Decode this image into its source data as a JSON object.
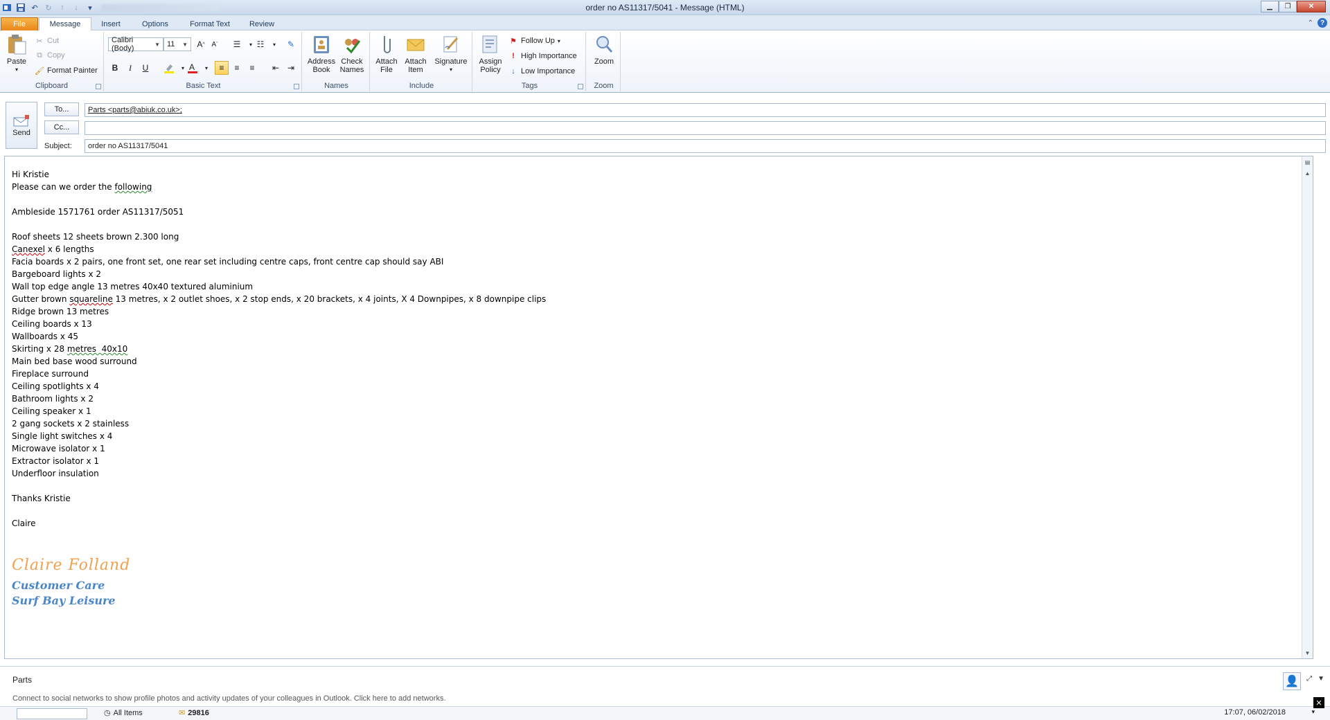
{
  "window": {
    "title": "order no AS11317/5041 - Message (HTML)"
  },
  "tabs": [
    {
      "label": "File"
    },
    {
      "label": "Message"
    },
    {
      "label": "Insert"
    },
    {
      "label": "Options"
    },
    {
      "label": "Format Text"
    },
    {
      "label": "Review"
    }
  ],
  "ribbon": {
    "clipboard": {
      "paste": "Paste",
      "cut": "Cut",
      "copy": "Copy",
      "format_painter": "Format Painter",
      "group_label": "Clipboard"
    },
    "basic_text": {
      "font_name": "Calibri (Body)",
      "font_size": "11",
      "bold": "B",
      "italic": "I",
      "underline": "U",
      "group_label": "Basic Text"
    },
    "names": {
      "address_book_l1": "Address",
      "address_book_l2": "Book",
      "check_names_l1": "Check",
      "check_names_l2": "Names",
      "group_label": "Names"
    },
    "include": {
      "attach_file_l1": "Attach",
      "attach_file_l2": "File",
      "attach_item_l1": "Attach",
      "attach_item_l2": "Item",
      "signature": "Signature",
      "group_label": "Include"
    },
    "tags": {
      "assign_policy_l1": "Assign",
      "assign_policy_l2": "Policy",
      "follow_up": "Follow Up",
      "high_importance": "High Importance",
      "low_importance": "Low Importance",
      "group_label": "Tags"
    },
    "zoom": {
      "zoom": "Zoom",
      "group_label": "Zoom"
    }
  },
  "header": {
    "send": "Send",
    "to_button": "To...",
    "cc_button": "Cc...",
    "subject_label": "Subject:",
    "to_value": "Parts <parts@abiuk.co.uk>;",
    "cc_value": "",
    "subject_value": "order no AS11317/5041"
  },
  "body": {
    "greeting": "Hi Kristie",
    "intro_a": "Please can we order the ",
    "intro_b": "following",
    "ref": "Ambleside 1571761 order AS11317/5051",
    "item_roof": "Roof sheets 12 sheets brown 2.300 long",
    "item_canexel_a": "Canexel",
    "item_canexel_b": " x 6 lengths",
    "item_facia": "Facia boards x 2 pairs, one front set, one rear set including centre caps, front centre cap should say ABI",
    "item_bargeboard": "Bargeboard lights x 2",
    "item_walltop": "Wall top edge angle 13 metres 40x40 textured aluminium",
    "item_gutter_a": "Gutter brown ",
    "item_gutter_b": "squareline",
    "item_gutter_c": " 13 metres, x 2 outlet shoes, x 2 stop ends, x 20 brackets, x 4 joints, X 4 Downpipes, x 8 downpipe clips",
    "item_ridge": "Ridge brown 13 metres",
    "item_ceiling_boards": "Ceiling boards x 13",
    "item_wallboards": "Wallboards x 45",
    "item_skirting_a": "Skirting x 28 ",
    "item_skirting_b": "metres  40x10",
    "item_mainbed": "Main bed base wood surround",
    "item_fireplace": "Fireplace surround",
    "item_spotlights": "Ceiling spotlights x 4",
    "item_bathroom": "Bathroom lights x 2",
    "item_speaker": "Ceiling speaker x 1",
    "item_sockets": "2 gang sockets x 2 stainless",
    "item_switches": "Single light switches x 4",
    "item_microwave": "Microwave isolator x 1",
    "item_extractor": "Extractor isolator x 1",
    "item_underfloor": "Underfloor insulation",
    "thanks": "Thanks Kristie",
    "sender": "Claire",
    "sig_name": "Claire Folland",
    "sig_role": "Customer Care",
    "sig_company": "Surf Bay Leisure"
  },
  "people_pane": {
    "name": "Parts",
    "note": "Connect to social networks to show profile photos and activity updates of your colleagues in Outlook. Click here to add networks."
  },
  "bottom": {
    "all_items": "All Items",
    "item_number": "29816",
    "timestamp": "17:07, 06/02/2018"
  },
  "colors": {
    "file_tab": "#e9871a",
    "signature_name": "#f0a050",
    "signature_role": "#4a86c8"
  }
}
